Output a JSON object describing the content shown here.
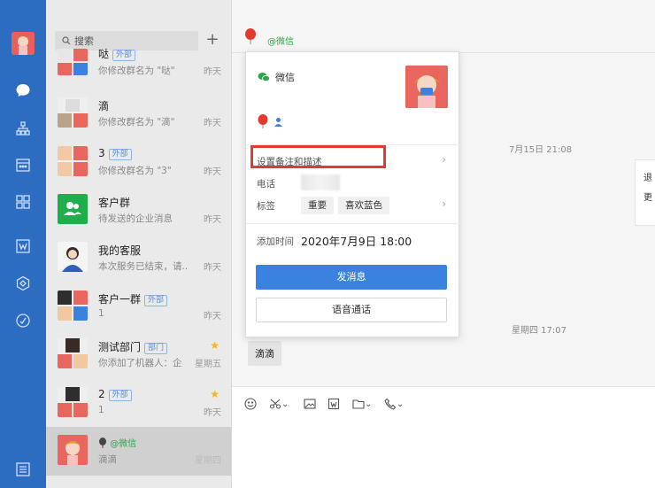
{
  "colors": {
    "rail": "#2c6cc1",
    "accent": "#3b82e0",
    "highlight": "#e23a2e",
    "star": "#f5b616",
    "wechat_green": "#2aa64a"
  },
  "search": {
    "placeholder": "搜索"
  },
  "conversations": [
    {
      "name": "哒",
      "tag": "外部",
      "sub": "你修改群名为 \"哒\"",
      "time": "昨天"
    },
    {
      "name": "滴",
      "tag": "",
      "sub": "你修改群名为 \"滴\"",
      "time": "昨天"
    },
    {
      "name": "3",
      "tag": "外部",
      "sub": "你修改群名为 \"3\"",
      "time": "昨天"
    },
    {
      "name": "客户群",
      "tag": "",
      "sub": "待发送的企业消息",
      "time": "昨天"
    },
    {
      "name": "我的客服",
      "tag": "",
      "sub": "本次服务已结束，请...",
      "time": "昨天"
    },
    {
      "name": "客户一群",
      "tag": "外部",
      "sub": "1",
      "time": "昨天"
    },
    {
      "name": "测试部门",
      "tag": "部门",
      "sub": "你添加了机器人：企",
      "time": "星期五"
    },
    {
      "name": "2",
      "tag": "外部",
      "sub": "1",
      "time": "昨天"
    },
    {
      "name": "@微信",
      "tag": "",
      "sub": "滴滴",
      "time": "星期四"
    }
  ],
  "chat": {
    "title": "@微信",
    "timestamp_1": "7月15日 21:08",
    "timestamp_2": "星期四 17:07",
    "bubble": "滴滴"
  },
  "card": {
    "source": "微信",
    "remark_label": "设置备注和描述",
    "phone_label": "电话",
    "tags_label": "标签",
    "tags": [
      "重要",
      "喜欢蓝色"
    ],
    "added_label": "添加时间",
    "added_value": "2020年7月9日 18:00",
    "send_button": "发消息",
    "voice_button": "语音通话"
  },
  "side_card": {
    "line1": "退",
    "line2": "更"
  }
}
